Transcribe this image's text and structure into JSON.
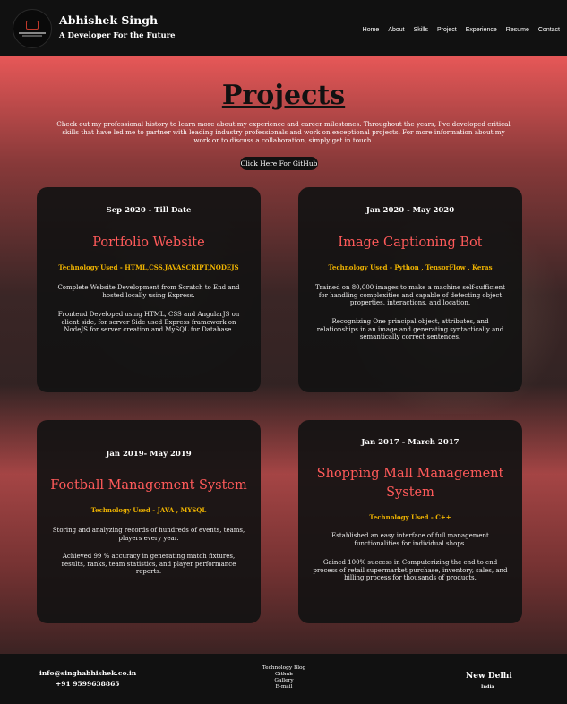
{
  "header": {
    "name": "Abhishek Singh",
    "tagline": "A Developer For the Future",
    "nav": [
      "Home",
      "About",
      "Skills",
      "Project",
      "Experience",
      "Resume",
      "Contact"
    ]
  },
  "page": {
    "title": "Projects",
    "intro": "Check out my professional history to learn more about my experience and career milestones. Throughout the years, I've developed critical skills that have led me to partner with leading industry professionals and work on exceptional projects. For more information about my work or to discuss a collaboration, simply get in touch.",
    "github_button": "Click Here For GitHub"
  },
  "projects": [
    {
      "date": "Sep 2020 - Till Date",
      "title": "Portfolio Website",
      "tech": "Technology Used - HTML,CSS,JAVASCRIPT,NODEJS",
      "desc1": "Complete Website Development from Scratch to End and hosted locally using Express.",
      "desc2": "Frontend Developed using HTML, CSS and AngularJS on client side, for server Side used Express framework on NodeJS for server creation and MySQL for Database."
    },
    {
      "date": "Jan 2020 - May 2020",
      "title": "Image Captioning Bot",
      "tech": "Technology Used - Python , TensorFlow , Keras",
      "desc1": "Trained on 80,000 images to make a machine self-sufficient for handling complexities and capable of detecting object properties, interactions, and location.",
      "desc2": "Recognizing One principal object, attributes, and relationships in an image and generating syntactically and semantically correct sentences."
    },
    {
      "date": "Jan 2019- May 2019",
      "title": "Football Management System",
      "tech": "Technology Used - JAVA , MYSQL",
      "desc1": "Storing and analyzing records of hundreds of events, teams, players every year.",
      "desc2": "Achieved 99 % accuracy in generating match fixtures, results, ranks, team statistics, and player performance reports."
    },
    {
      "date": "Jan 2017 - March 2017",
      "title": "Shopping Mall Management System",
      "tech": "Technology Used - C++",
      "desc1": "Established an easy interface of full management functionalities for individual shops.",
      "desc2": "Gained 100% success in Computerizing the end to end process of retail supermarket purchase, inventory, sales, and billing process for thousands of products."
    }
  ],
  "footer": {
    "email": "info@singhabhishek.co.in",
    "phone": "+91 9599638865",
    "links": [
      "Technology Blog",
      "Github",
      "Gallery",
      "E-mail"
    ],
    "city": "New Delhi",
    "country": "India"
  },
  "colors": {
    "accent": "#ff5a5a",
    "tech_label": "#f0b400",
    "hero_tint": "#f05a5a"
  }
}
